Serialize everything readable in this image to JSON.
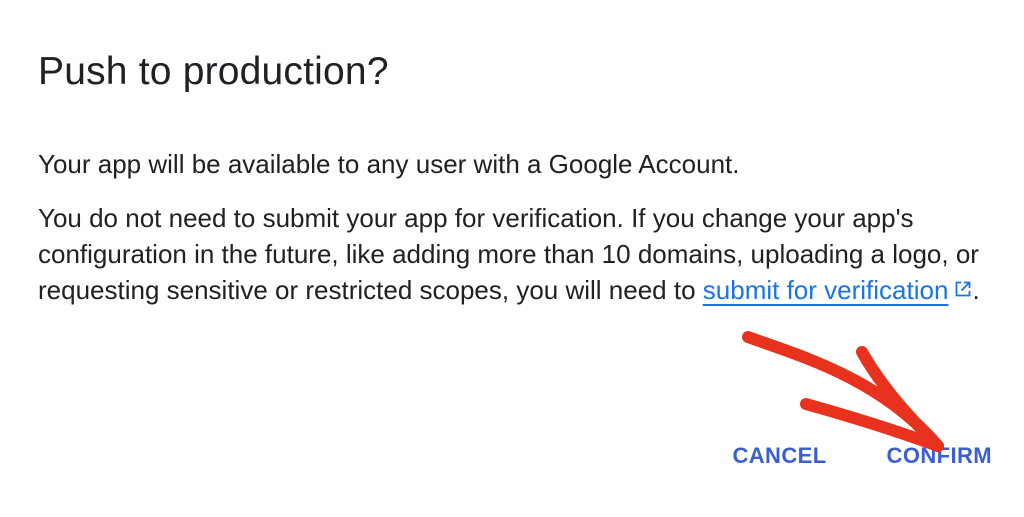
{
  "dialog": {
    "title": "Push to production?",
    "paragraph_1": "Your app will be available to any user with a Google Account.",
    "paragraph_2_text": "You do not need to submit your app for verification. If you change your app's configuration in the future, like adding more than 10 domains, uploading a logo, or requesting sensitive or restricted scopes, you will need to ",
    "paragraph_2_link": "submit for verification",
    "paragraph_2_end": ".",
    "link_icon": "external-link-icon"
  },
  "actions": {
    "cancel_label": "CANCEL",
    "confirm_label": "CONFIRM"
  },
  "annotation": {
    "icon": "red-arrow",
    "color": "#e8321e"
  },
  "colors": {
    "text": "#202124",
    "link": "#1a73e8",
    "button": "#3b5fd3",
    "background": "#ffffff"
  }
}
